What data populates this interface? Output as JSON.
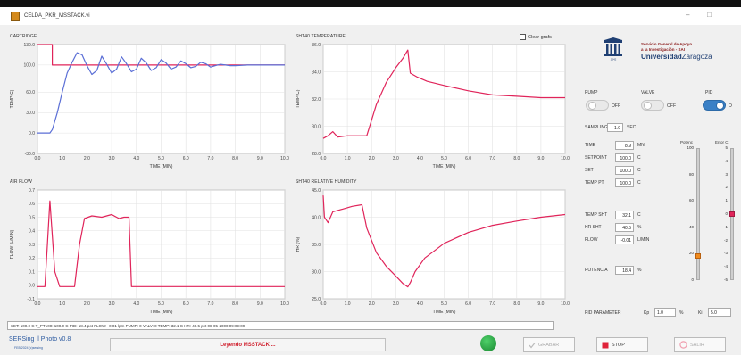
{
  "window": {
    "title": "CELDA_PKR_MSSTACK.vi"
  },
  "clear_graph_label": "Clear grafs",
  "logo": {
    "line1": "Servicio General de Apoyo",
    "line2": "a la Investigación - SAI",
    "line3a": "Universidad",
    "line3b": "Zaragoza",
    "year": "1542"
  },
  "toggles": [
    {
      "label": "PUMP",
      "state": "OFF",
      "on": false
    },
    {
      "label": "VALVE",
      "state": "OFF",
      "on": false
    },
    {
      "label": "PID",
      "state": "O",
      "on": true
    }
  ],
  "sampling": {
    "label": "SAMPLING",
    "value": "1.0",
    "unit": "SEC"
  },
  "readouts": [
    {
      "label": "TIME",
      "value": "8.9",
      "unit": "MN"
    },
    {
      "label": "SETPOINT",
      "value": "100.0",
      "unit": "C"
    },
    {
      "label": "SET",
      "value": "100.0",
      "unit": "C"
    },
    {
      "label": "TEMP PT",
      "value": "100.0",
      "unit": "C"
    },
    {
      "label": "TEMP SHT",
      "value": "32.1",
      "unit": "C"
    },
    {
      "label": "HR SHT",
      "value": "40.5",
      "unit": "%"
    },
    {
      "label": "FLOW",
      "value": "-0.01",
      "unit": "L/MIN"
    },
    {
      "label": "POTENCIA",
      "value": "18.4",
      "unit": "%"
    }
  ],
  "slider_power": {
    "label": "Potenc",
    "ticks": [
      "100",
      "80",
      "60",
      "40",
      "20",
      "0"
    ],
    "level_percent": 18.4
  },
  "slider_error": {
    "label": "Error C",
    "ticks": [
      "5",
      "4",
      "3",
      "2",
      "1",
      "0",
      "-1",
      "-2",
      "-3",
      "-4",
      "-5"
    ],
    "level": 0
  },
  "pid_param": {
    "label": "PID PARAMETER",
    "kp_label": "Kp",
    "kp": "1.0",
    "kp_unit": "%",
    "ki_label": "Ki",
    "ki": "5.0"
  },
  "status_text": "SET: 100.0 C  T_PT100: 100.0 C  PID: 18.4 pot  FLOW: -0.01 lpm  PUMP: 0  VALV: 0  TEMP: 32.1 C  HR: 40.5 pct  08-05-2000  09:09:09",
  "version": "SERSing Il Photo v0.8",
  "version_sub": "FEB 2024 (c)sersing",
  "banner": "Leyendo MSSTACK ...",
  "buttons": [
    {
      "label": "GRABAR",
      "disabled": true
    },
    {
      "label": "STOP",
      "disabled": false
    },
    {
      "label": "SALIR",
      "disabled": true
    }
  ],
  "colors": {
    "series_blue": "#5b6fd6",
    "series_red": "#e0245a",
    "pid_on": "#3a80c6",
    "led": "#20a040",
    "banner_text": "#d0202e"
  },
  "chart_data": [
    {
      "type": "line",
      "title": "CARTRIDGE",
      "xlabel": "TIME (MIN)",
      "ylabel": "TEMP(C)",
      "xlim": [
        0,
        10
      ],
      "ylim": [
        -30,
        130
      ],
      "yticks": [
        -30,
        0,
        30,
        60,
        100,
        130
      ],
      "ytick_labels": [
        "-30.0",
        "0.0",
        "30.0",
        "60.0",
        "100.0",
        "130.0"
      ],
      "series": [
        {
          "color": "#e0245a",
          "x": [
            0,
            0.6,
            0.6,
            10
          ],
          "y": [
            130,
            130,
            100,
            100
          ]
        },
        {
          "color": "#5b6fd6",
          "x": [
            0,
            0.5,
            0.6,
            0.8,
            1.0,
            1.2,
            1.4,
            1.6,
            1.8,
            2.0,
            2.2,
            2.4,
            2.6,
            2.8,
            3.0,
            3.2,
            3.4,
            3.6,
            3.8,
            4.0,
            4.2,
            4.4,
            4.6,
            4.8,
            5.0,
            5.2,
            5.4,
            5.6,
            5.8,
            6.0,
            6.2,
            6.4,
            6.6,
            6.8,
            7.0,
            7.2,
            7.4,
            7.6,
            7.8,
            8.0,
            8.5,
            9.0,
            9.5,
            10.0
          ],
          "y": [
            0,
            0,
            5,
            30,
            60,
            88,
            104,
            118,
            115,
            99,
            86,
            92,
            113,
            101,
            88,
            94,
            112,
            102,
            90,
            94,
            110,
            103,
            92,
            96,
            108,
            103,
            94,
            97,
            106,
            102,
            96,
            98,
            104,
            102,
            97,
            99,
            101,
            100,
            99,
            99,
            100,
            100,
            100,
            100
          ]
        }
      ]
    },
    {
      "type": "line",
      "title": "SHT40 TEMPERATURE",
      "xlabel": "TIME (MIN)",
      "ylabel": "TEMP(C)",
      "xlim": [
        0,
        10
      ],
      "ylim": [
        28,
        36
      ],
      "yticks": [
        28,
        30,
        32,
        34,
        36
      ],
      "ytick_labels": [
        "28.0",
        "30.0",
        "32.0",
        "34.0",
        "36.0"
      ],
      "series": [
        {
          "color": "#e0245a",
          "x": [
            0,
            0.2,
            0.4,
            0.6,
            1.0,
            1.5,
            1.8,
            2.2,
            2.6,
            3.0,
            3.3,
            3.5,
            3.6,
            3.9,
            4.3,
            5.0,
            6.0,
            7.0,
            8.0,
            9.0,
            10.0
          ],
          "y": [
            29.1,
            29.3,
            29.6,
            29.2,
            29.3,
            29.3,
            29.3,
            31.6,
            33.2,
            34.3,
            35.0,
            35.6,
            33.9,
            33.6,
            33.3,
            33.0,
            32.6,
            32.3,
            32.2,
            32.1,
            32.1
          ]
        }
      ]
    },
    {
      "type": "line",
      "title": "AIR FLOW",
      "xlabel": "TIME (MIN)",
      "ylabel": "FLOW (L/MIN)",
      "xlim": [
        0,
        10
      ],
      "ylim": [
        -0.1,
        0.7
      ],
      "yticks": [
        -0.1,
        0,
        0.1,
        0.2,
        0.3,
        0.4,
        0.5,
        0.6,
        0.7
      ],
      "ytick_labels": [
        "-0.1",
        "0.0",
        "0.1",
        "0.2",
        "0.3",
        "0.4",
        "0.5",
        "0.6",
        "0.7"
      ],
      "series": [
        {
          "color": "#e0245a",
          "x": [
            0,
            0.3,
            0.4,
            0.5,
            0.7,
            0.9,
            1.5,
            1.7,
            1.9,
            2.2,
            2.6,
            3.0,
            3.3,
            3.5,
            3.7,
            3.8,
            4.5,
            10.0
          ],
          "y": [
            -0.01,
            -0.01,
            0.3,
            0.62,
            0.1,
            -0.01,
            -0.01,
            0.3,
            0.49,
            0.51,
            0.5,
            0.52,
            0.49,
            0.5,
            0.5,
            -0.01,
            -0.01,
            -0.01
          ]
        }
      ]
    },
    {
      "type": "line",
      "title": "SHT40 RELATIVE HUMIDITY",
      "xlabel": "TIME (MIN)",
      "ylabel": "HR (%)",
      "xlim": [
        0,
        10
      ],
      "ylim": [
        25,
        45
      ],
      "yticks": [
        25,
        30,
        35,
        40,
        45
      ],
      "ytick_labels": [
        "25.0",
        "30.0",
        "35.0",
        "40.0",
        "45.0"
      ],
      "series": [
        {
          "color": "#e0245a",
          "x": [
            0,
            0.05,
            0.2,
            0.4,
            0.8,
            1.2,
            1.6,
            1.8,
            2.2,
            2.6,
            3.0,
            3.3,
            3.5,
            3.6,
            3.8,
            4.2,
            5.0,
            6.0,
            7.0,
            8.0,
            9.0,
            10.0
          ],
          "y": [
            44,
            40,
            39,
            41,
            41.5,
            42,
            42.3,
            38,
            33.5,
            31,
            29.2,
            27.8,
            27.2,
            28,
            30,
            32.5,
            35.2,
            37.2,
            38.5,
            39.3,
            40,
            40.5
          ]
        }
      ]
    }
  ]
}
